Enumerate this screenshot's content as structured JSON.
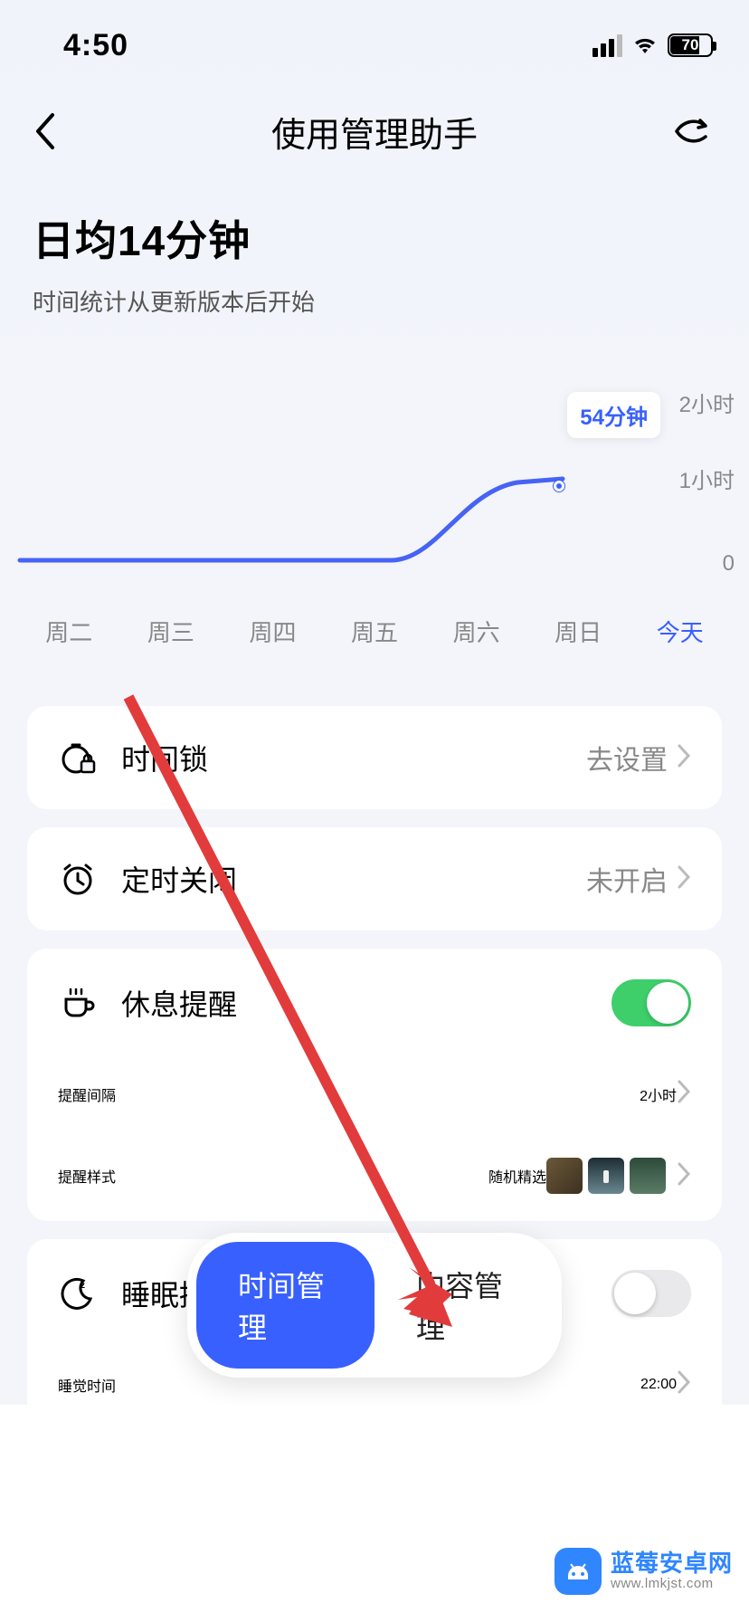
{
  "statusbar": {
    "time": "4:50",
    "battery": "70"
  },
  "header": {
    "title": "使用管理助手"
  },
  "summary": {
    "title": "日均14分钟",
    "subtitle": "时间统计从更新版本后开始"
  },
  "chart_data": {
    "type": "line",
    "categories": [
      "周二",
      "周三",
      "周四",
      "周五",
      "周六",
      "周日",
      "今天"
    ],
    "values": [
      0,
      0,
      0,
      0,
      0,
      0,
      54
    ],
    "unit": "分钟",
    "ylabels": [
      "2小时",
      "1小时",
      "0"
    ],
    "ylim_minutes": [
      0,
      120
    ],
    "tooltip": "54分钟",
    "active_index": 6
  },
  "settings": {
    "time_lock": {
      "label": "时间锁",
      "value": "去设置"
    },
    "timer_off": {
      "label": "定时关闭",
      "value": "未开启"
    },
    "rest_reminder": {
      "label": "休息提醒",
      "interval_label": "提醒间隔",
      "interval_value": "2小时",
      "style_label": "提醒样式",
      "style_value": "随机精选"
    },
    "sleep_reminder": {
      "label": "睡眠提醒",
      "time_label": "睡觉时间",
      "time_value": "22:00"
    }
  },
  "tabs": {
    "active": "时间管理",
    "inactive": "内容管理"
  },
  "watermark": {
    "title": "蓝莓安卓网",
    "url": "www.lmkjst.com"
  }
}
